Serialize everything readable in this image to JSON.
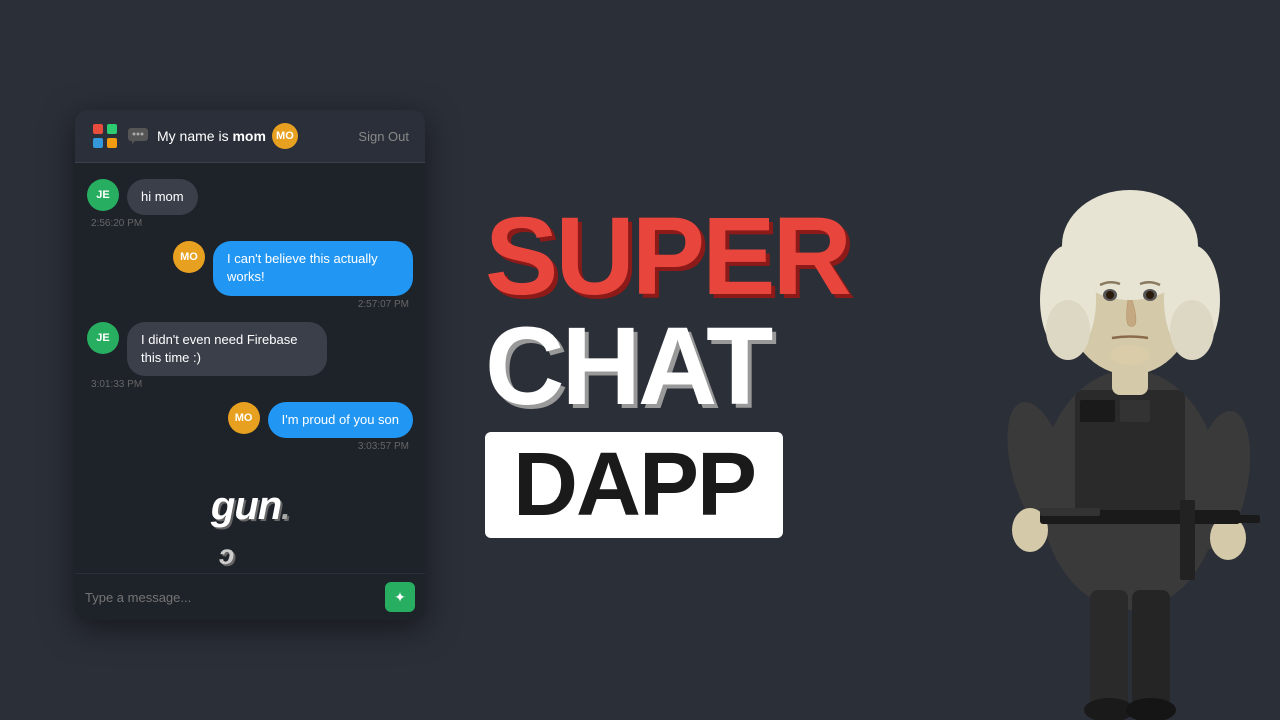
{
  "background": "#2b2f38",
  "chat": {
    "header": {
      "username": "My name is mom",
      "badge": "MO",
      "badge_color": "#e8a020",
      "sign_out_label": "Sign Out"
    },
    "messages": [
      {
        "id": 1,
        "sender": "JE",
        "sender_color": "#27ae60",
        "text": "hi mom",
        "time": "2:56:20 PM",
        "side": "left",
        "bubble_color": "gray"
      },
      {
        "id": 2,
        "sender": "MO",
        "sender_color": "#e8a020",
        "text": "I can't believe this actually works!",
        "time": "2:57:07 PM",
        "side": "right",
        "bubble_color": "blue"
      },
      {
        "id": 3,
        "sender": "JE",
        "sender_color": "#27ae60",
        "text": "I didn't even need Firebase this time :)",
        "time": "3:01:33 PM",
        "side": "left",
        "bubble_color": "gray"
      },
      {
        "id": 4,
        "sender": "MO",
        "sender_color": "#e8a020",
        "text": "I'm proud of you son",
        "time": "3:03:57 PM",
        "side": "right",
        "bubble_color": "blue"
      }
    ],
    "input_placeholder": "Type a message...",
    "gun_logo": "gun.",
    "gun_logo_sub": "c"
  },
  "title": {
    "super": "SUPER",
    "chat": "CHAT",
    "dapp": "DAPP"
  }
}
